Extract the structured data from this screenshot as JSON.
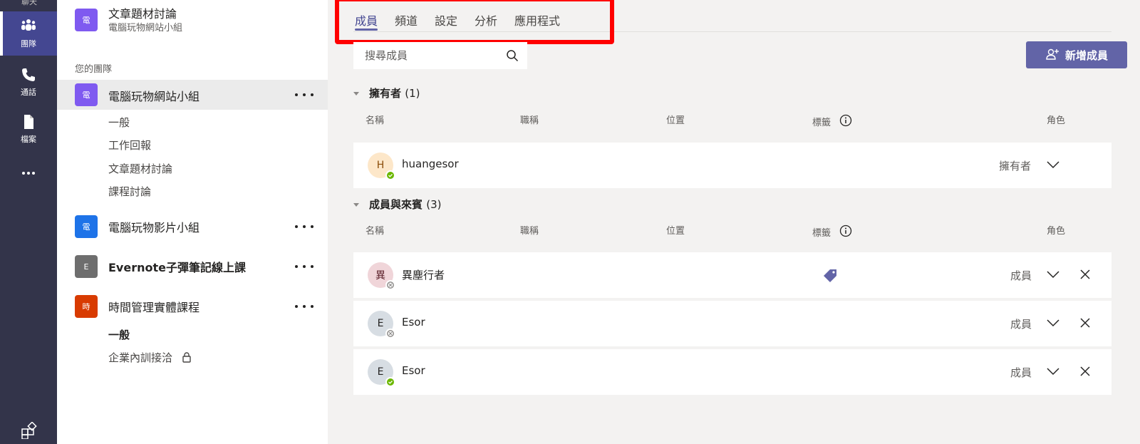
{
  "rail": {
    "top_stub": "聊天",
    "items": [
      {
        "label": "團隊",
        "icon": "teams-icon",
        "active": true
      },
      {
        "label": "通話",
        "icon": "phone-icon"
      },
      {
        "label": "檔案",
        "icon": "file-icon"
      },
      {
        "label": "",
        "icon": "more-icon"
      }
    ],
    "bottom_icon": "apps-icon"
  },
  "teams_panel": {
    "pinned_team": {
      "avatar": "電",
      "name": "文章題材討論",
      "subtitle": "電腦玩物網站小組"
    },
    "section_label": "您的團隊",
    "teams": [
      {
        "avatar": "電",
        "color": "#7f5af0",
        "name": "電腦玩物網站小組",
        "channels": [
          "一般",
          "工作回報",
          "文章題材討論",
          "課程討論"
        ]
      },
      {
        "avatar": "電",
        "color": "#1e73e8",
        "name": "電腦玩物影片小組",
        "channels": []
      },
      {
        "avatar": "E",
        "color": "#6e6e6e",
        "name": "Evernote子彈筆記線上課",
        "channels": []
      },
      {
        "avatar": "時",
        "color": "#d83b01",
        "name": "時間管理實體課程",
        "channels": [
          "一般",
          "企業內訓接洽"
        ]
      }
    ]
  },
  "tabs": [
    "成員",
    "頻道",
    "設定",
    "分析",
    "應用程式"
  ],
  "search": {
    "placeholder": "搜尋成員"
  },
  "add_member_label": "新增成員",
  "columns": {
    "name": "名稱",
    "title": "職稱",
    "location": "位置",
    "tags": "標籤",
    "role": "角色"
  },
  "owners": {
    "label": "擁有者",
    "count": "(1)",
    "members": [
      {
        "initial": "H",
        "name": "huangesor",
        "role": "擁有者",
        "status": "available"
      }
    ]
  },
  "members_guests": {
    "label": "成員與來賓",
    "count": "(3)",
    "members": [
      {
        "initial": "異",
        "name": "異塵行者",
        "role": "成員",
        "status": "offline",
        "has_tag": true
      },
      {
        "initial": "E",
        "name": "Esor",
        "role": "成員",
        "status": "offline"
      },
      {
        "initial": "E",
        "name": "Esor",
        "role": "成員",
        "status": "available"
      }
    ]
  },
  "colors": {
    "accent": "#6264a7",
    "highlight": "#ff0000",
    "rail": "#33344a"
  }
}
